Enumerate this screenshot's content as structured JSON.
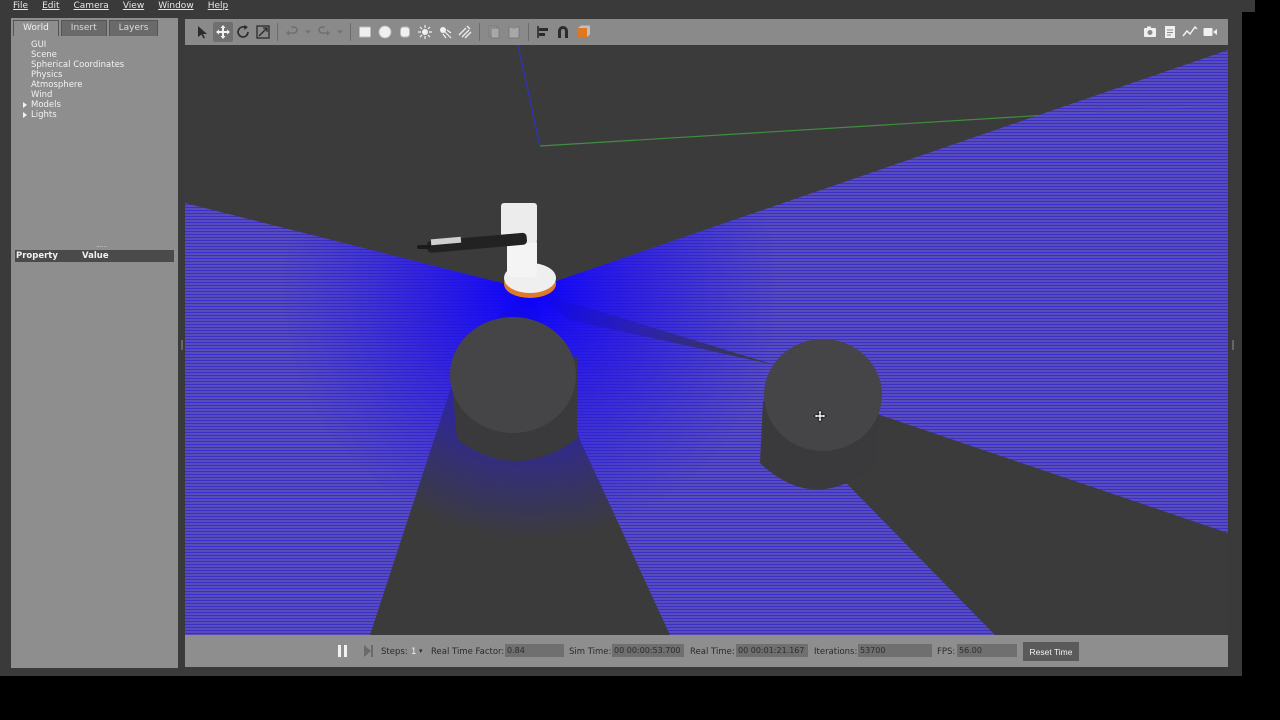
{
  "menu": [
    "File",
    "Edit",
    "Camera",
    "View",
    "Window",
    "Help"
  ],
  "left_panel": {
    "tabs": [
      {
        "label": "World",
        "active": true
      },
      {
        "label": "Insert",
        "active": false
      },
      {
        "label": "Layers",
        "active": false
      }
    ],
    "tree": [
      {
        "label": "GUI",
        "expandable": false
      },
      {
        "label": "Scene",
        "expandable": false
      },
      {
        "label": "Spherical Coordinates",
        "expandable": false
      },
      {
        "label": "Physics",
        "expandable": false
      },
      {
        "label": "Atmosphere",
        "expandable": false
      },
      {
        "label": "Wind",
        "expandable": false
      },
      {
        "label": "Models",
        "expandable": true
      },
      {
        "label": "Lights",
        "expandable": true
      }
    ],
    "property_header": {
      "property": "Property",
      "value": "Value"
    }
  },
  "toolbar_icons": [
    "select-arrow-icon",
    "translate-icon",
    "rotate-icon",
    "scale-icon",
    "undo-icon",
    "undo-dropdown-icon",
    "redo-icon",
    "redo-dropdown-icon",
    "box-shape-icon",
    "sphere-shape-icon",
    "cylinder-shape-icon",
    "point-light-icon",
    "spot-light-icon",
    "directional-light-icon",
    "copy-icon",
    "paste-icon",
    "align-icon",
    "snap-icon",
    "change-view-icon",
    "screenshot-icon",
    "log-icon",
    "plot-icon",
    "record-video-icon"
  ],
  "bottom_bar": {
    "steps_label": "Steps:",
    "steps_value": "1",
    "rtf_label": "Real Time Factor:",
    "rtf_value": "0.84",
    "sim_time_label": "Sim Time:",
    "sim_time_value": "00 00:00:53.700",
    "real_time_label": "Real Time:",
    "real_time_value": "00 00:01:21.167",
    "iterations_label": "Iterations:",
    "iterations_value": "53700",
    "fps_label": "FPS:",
    "fps_value": "56.00",
    "reset_label": "Reset Time"
  },
  "colors": {
    "laser": "#2a1fe0",
    "ground": "#3b3b3b",
    "obstacle": "#3a3a3c",
    "panel": "#8e8e8e",
    "axis_green": "#3f8f3f",
    "axis_blue": "#3030c8"
  }
}
